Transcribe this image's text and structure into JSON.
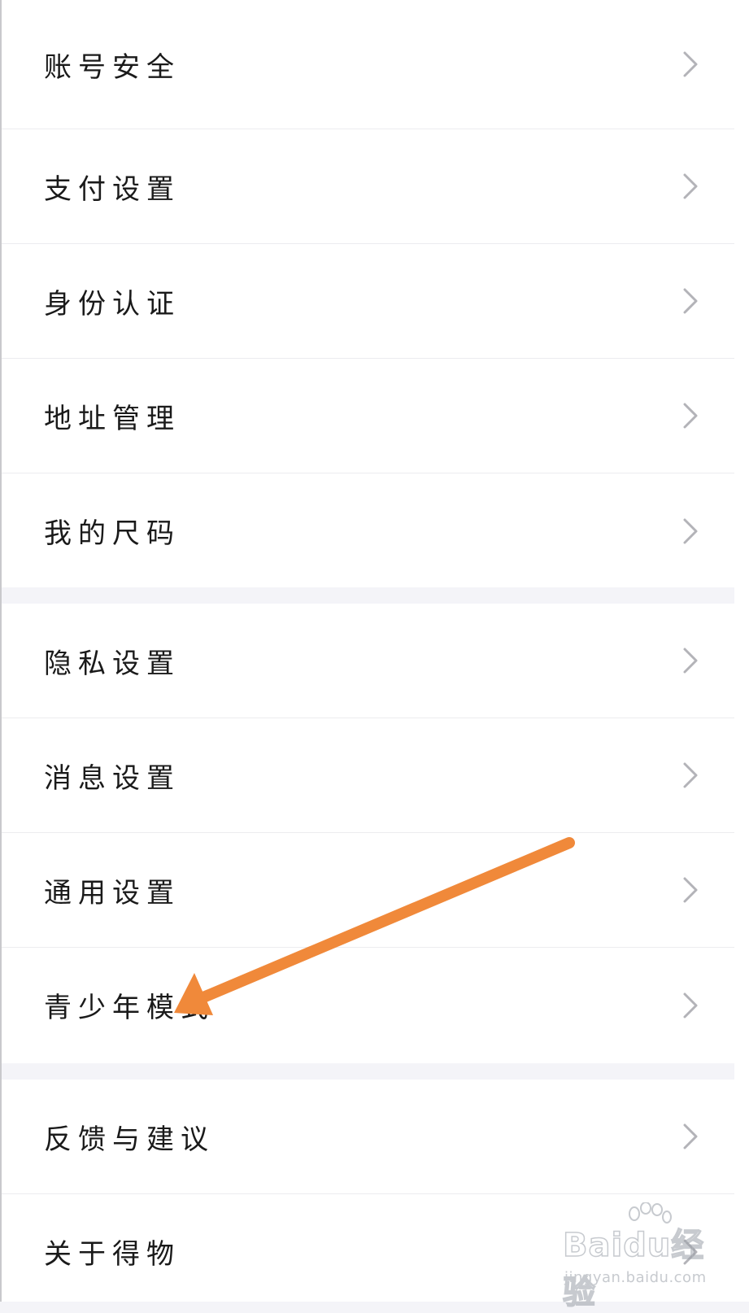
{
  "groups": [
    {
      "items": [
        {
          "label": "账号安全"
        },
        {
          "label": "支付设置"
        },
        {
          "label": "身份认证"
        },
        {
          "label": "地址管理"
        },
        {
          "label": "我的尺码"
        }
      ]
    },
    {
      "items": [
        {
          "label": "隐私设置"
        },
        {
          "label": "消息设置"
        },
        {
          "label": "通用设置"
        },
        {
          "label": "青少年模式"
        }
      ]
    },
    {
      "items": [
        {
          "label": "反馈与建议"
        },
        {
          "label": "关于得物"
        }
      ]
    }
  ],
  "watermark": {
    "brand": "Baidu经验",
    "url": "jingyan.baidu.com"
  },
  "colors": {
    "background": "#f4f4f8",
    "row_background": "#ffffff",
    "text": "#1a1a1a",
    "chevron": "#b3b3b8",
    "annotation_arrow": "#f0893a"
  },
  "icons": {
    "row_chevron": "chevron-right-icon",
    "annotation": "arrow-annotation-icon"
  }
}
